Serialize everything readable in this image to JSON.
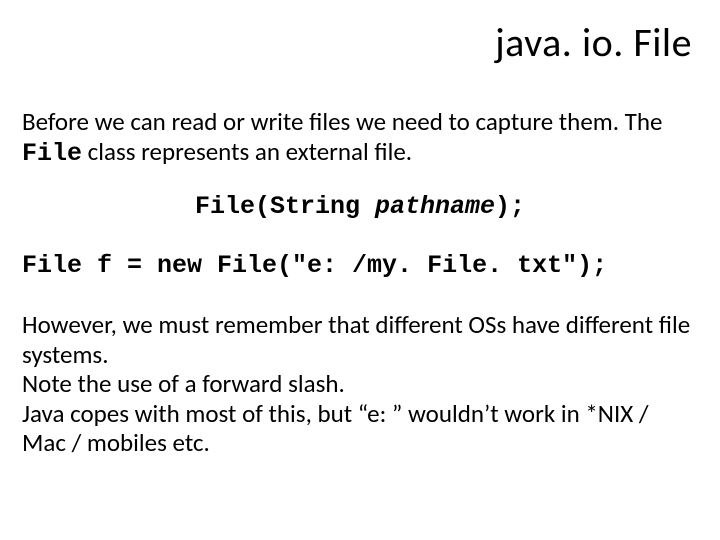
{
  "title": "java. io. File",
  "intro_part1": "Before we can read or write files we need to capture them. The ",
  "intro_file": "File",
  "intro_part2": " class represents an external file.",
  "sig_prefix": "File(String ",
  "sig_param": "pathname",
  "sig_suffix": ");",
  "example": "File f = new File(\"e: /my. File. txt\");",
  "body2_l1": "However, we must remember that different OSs have different file systems.",
  "body2_l2": "Note the use of a forward slash.",
  "body2_l3": "Java copes with most of this, but “e: ” wouldn’t work in *NIX / Mac / mobiles etc."
}
